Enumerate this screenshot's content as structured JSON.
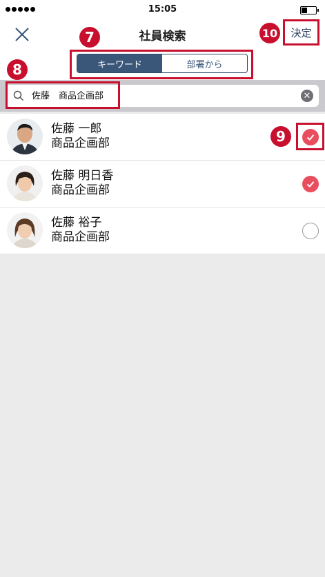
{
  "status_bar": {
    "time": "15:05",
    "signal_icon": "signal-dots-icon",
    "battery_icon": "battery-icon"
  },
  "nav": {
    "title": "社員検索",
    "close_icon": "close-icon",
    "confirm_label": "決定"
  },
  "segments": [
    {
      "label": "キーワード",
      "active": true
    },
    {
      "label": "部署から",
      "active": false
    }
  ],
  "search": {
    "value": "佐藤　商品企画部",
    "placeholder": "",
    "search_icon": "search-icon",
    "clear_icon": "clear-icon"
  },
  "results": [
    {
      "name": "佐藤 一郎",
      "dept": "商品企画部",
      "checked": true
    },
    {
      "name": "佐藤 明日香",
      "dept": "商品企画部",
      "checked": true
    },
    {
      "name": "佐藤 裕子",
      "dept": "商品企画部",
      "checked": false
    }
  ],
  "annotations": {
    "segment_marker": "7",
    "search_marker": "8",
    "check_marker": "9",
    "confirm_marker": "10"
  },
  "colors": {
    "accent": "#e84e5e",
    "highlight": "#c8102e",
    "segment_active": "#3a577a"
  }
}
